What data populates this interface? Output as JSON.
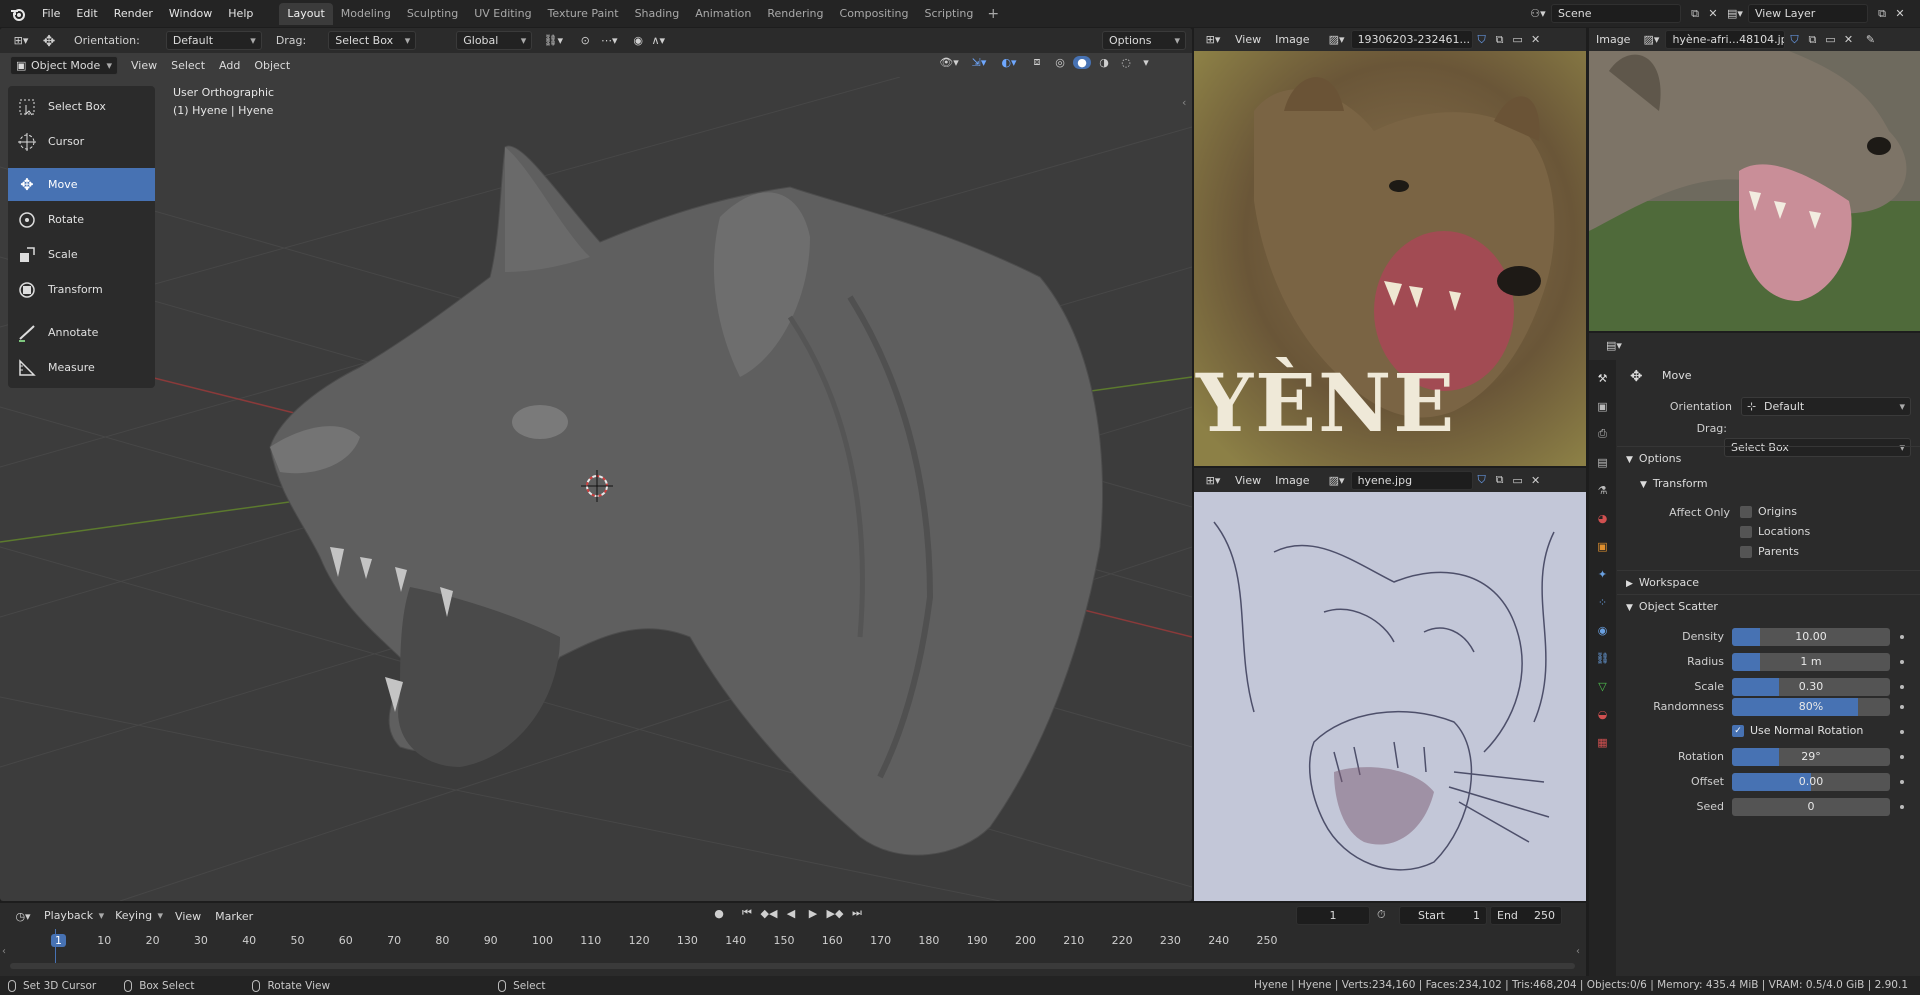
{
  "topbar": {
    "menus": [
      "File",
      "Edit",
      "Render",
      "Window",
      "Help"
    ],
    "tabs": [
      "Layout",
      "Modeling",
      "Sculpting",
      "UV Editing",
      "Texture Paint",
      "Shading",
      "Animation",
      "Rendering",
      "Compositing",
      "Scripting"
    ],
    "active_tab": "Layout",
    "plus": "+",
    "scene": "Scene",
    "view_layer": "View Layer"
  },
  "viewport": {
    "tool_header": {
      "orientation_label": "Orientation:",
      "orientation_value": "Default",
      "drag_label": "Drag:",
      "drag_value": "Select Box",
      "transform_space": "Global",
      "options": "Options"
    },
    "header": {
      "mode": "Object Mode",
      "menus": [
        "View",
        "Select",
        "Add",
        "Object"
      ]
    },
    "overlay": {
      "view_name": "User Orthographic",
      "object_name": "(1) Hyene | Hyene"
    },
    "tools": [
      {
        "label": "Select Box",
        "icon": "select-box-icon"
      },
      {
        "label": "Cursor",
        "icon": "cursor-icon"
      },
      {
        "label": "Move",
        "icon": "move-icon",
        "active": true
      },
      {
        "label": "Rotate",
        "icon": "rotate-icon"
      },
      {
        "label": "Scale",
        "icon": "scale-icon"
      },
      {
        "label": "Transform",
        "icon": "transform-icon"
      },
      {
        "label": "Annotate",
        "icon": "annotate-icon"
      },
      {
        "label": "Measure",
        "icon": "measure-icon"
      }
    ]
  },
  "image_editor_a": {
    "menus": [
      "View",
      "Image"
    ],
    "image_name": "19306203-232461..."
  },
  "image_editor_b": {
    "menus": [
      "Image"
    ],
    "image_name": "hyène-afri...48104.jpg"
  },
  "image_editor_c": {
    "menus": [
      "View",
      "Image"
    ],
    "image_name": "hyene.jpg"
  },
  "image_overlay_text": "YÈNE",
  "properties": {
    "tool_name": "Move",
    "orientation_label": "Orientation",
    "orientation_value": "Default",
    "drag_label": "Drag:",
    "drag_value": "Select Box",
    "options_section": "Options",
    "transform_section": "Transform",
    "affect_only_label": "Affect Only",
    "affect_only": [
      "Origins",
      "Locations",
      "Parents"
    ],
    "workspace_section": "Workspace",
    "scatter_section": "Object Scatter",
    "scatter": [
      {
        "label": "Density",
        "value": "10.00",
        "fill": 0.18
      },
      {
        "label": "Radius",
        "value": "1 m",
        "fill": 0.18
      },
      {
        "label": "Scale",
        "value": "0.30",
        "fill": 0.3
      },
      {
        "label": "Randomness",
        "value": "80%",
        "fill": 0.8
      },
      {
        "label": "Rotation",
        "value": "29°",
        "fill": 0.3
      },
      {
        "label": "Offset",
        "value": "0.00",
        "fill": 0.5
      },
      {
        "label": "Seed",
        "value": "0",
        "fill": 0
      }
    ],
    "use_normal_rotation": "Use Normal Rotation"
  },
  "timeline": {
    "menus": [
      "Playback",
      "Keying",
      "View",
      "Marker"
    ],
    "current_frame": "1",
    "start_label": "Start",
    "start": "1",
    "end_label": "End",
    "end": "250",
    "ruler": [
      "1",
      "10",
      "20",
      "30",
      "40",
      "50",
      "60",
      "70",
      "80",
      "90",
      "100",
      "110",
      "120",
      "130",
      "140",
      "150",
      "160",
      "170",
      "180",
      "190",
      "200",
      "210",
      "220",
      "230",
      "240",
      "250"
    ]
  },
  "statusbar": {
    "items": [
      "Set 3D Cursor",
      "Box Select",
      "Rotate View",
      "Select"
    ],
    "stats": "Hyene | Hyene | Verts:234,160 | Faces:234,102 | Tris:468,204 | Objects:0/6 | Memory: 435.4 MiB | VRAM: 0.5/4.0 GiB | 2.90.1"
  },
  "colors": {
    "accent": "#4772b3",
    "viewport_bg": "#3c3c3c",
    "panel_bg": "#2b2b2b"
  }
}
